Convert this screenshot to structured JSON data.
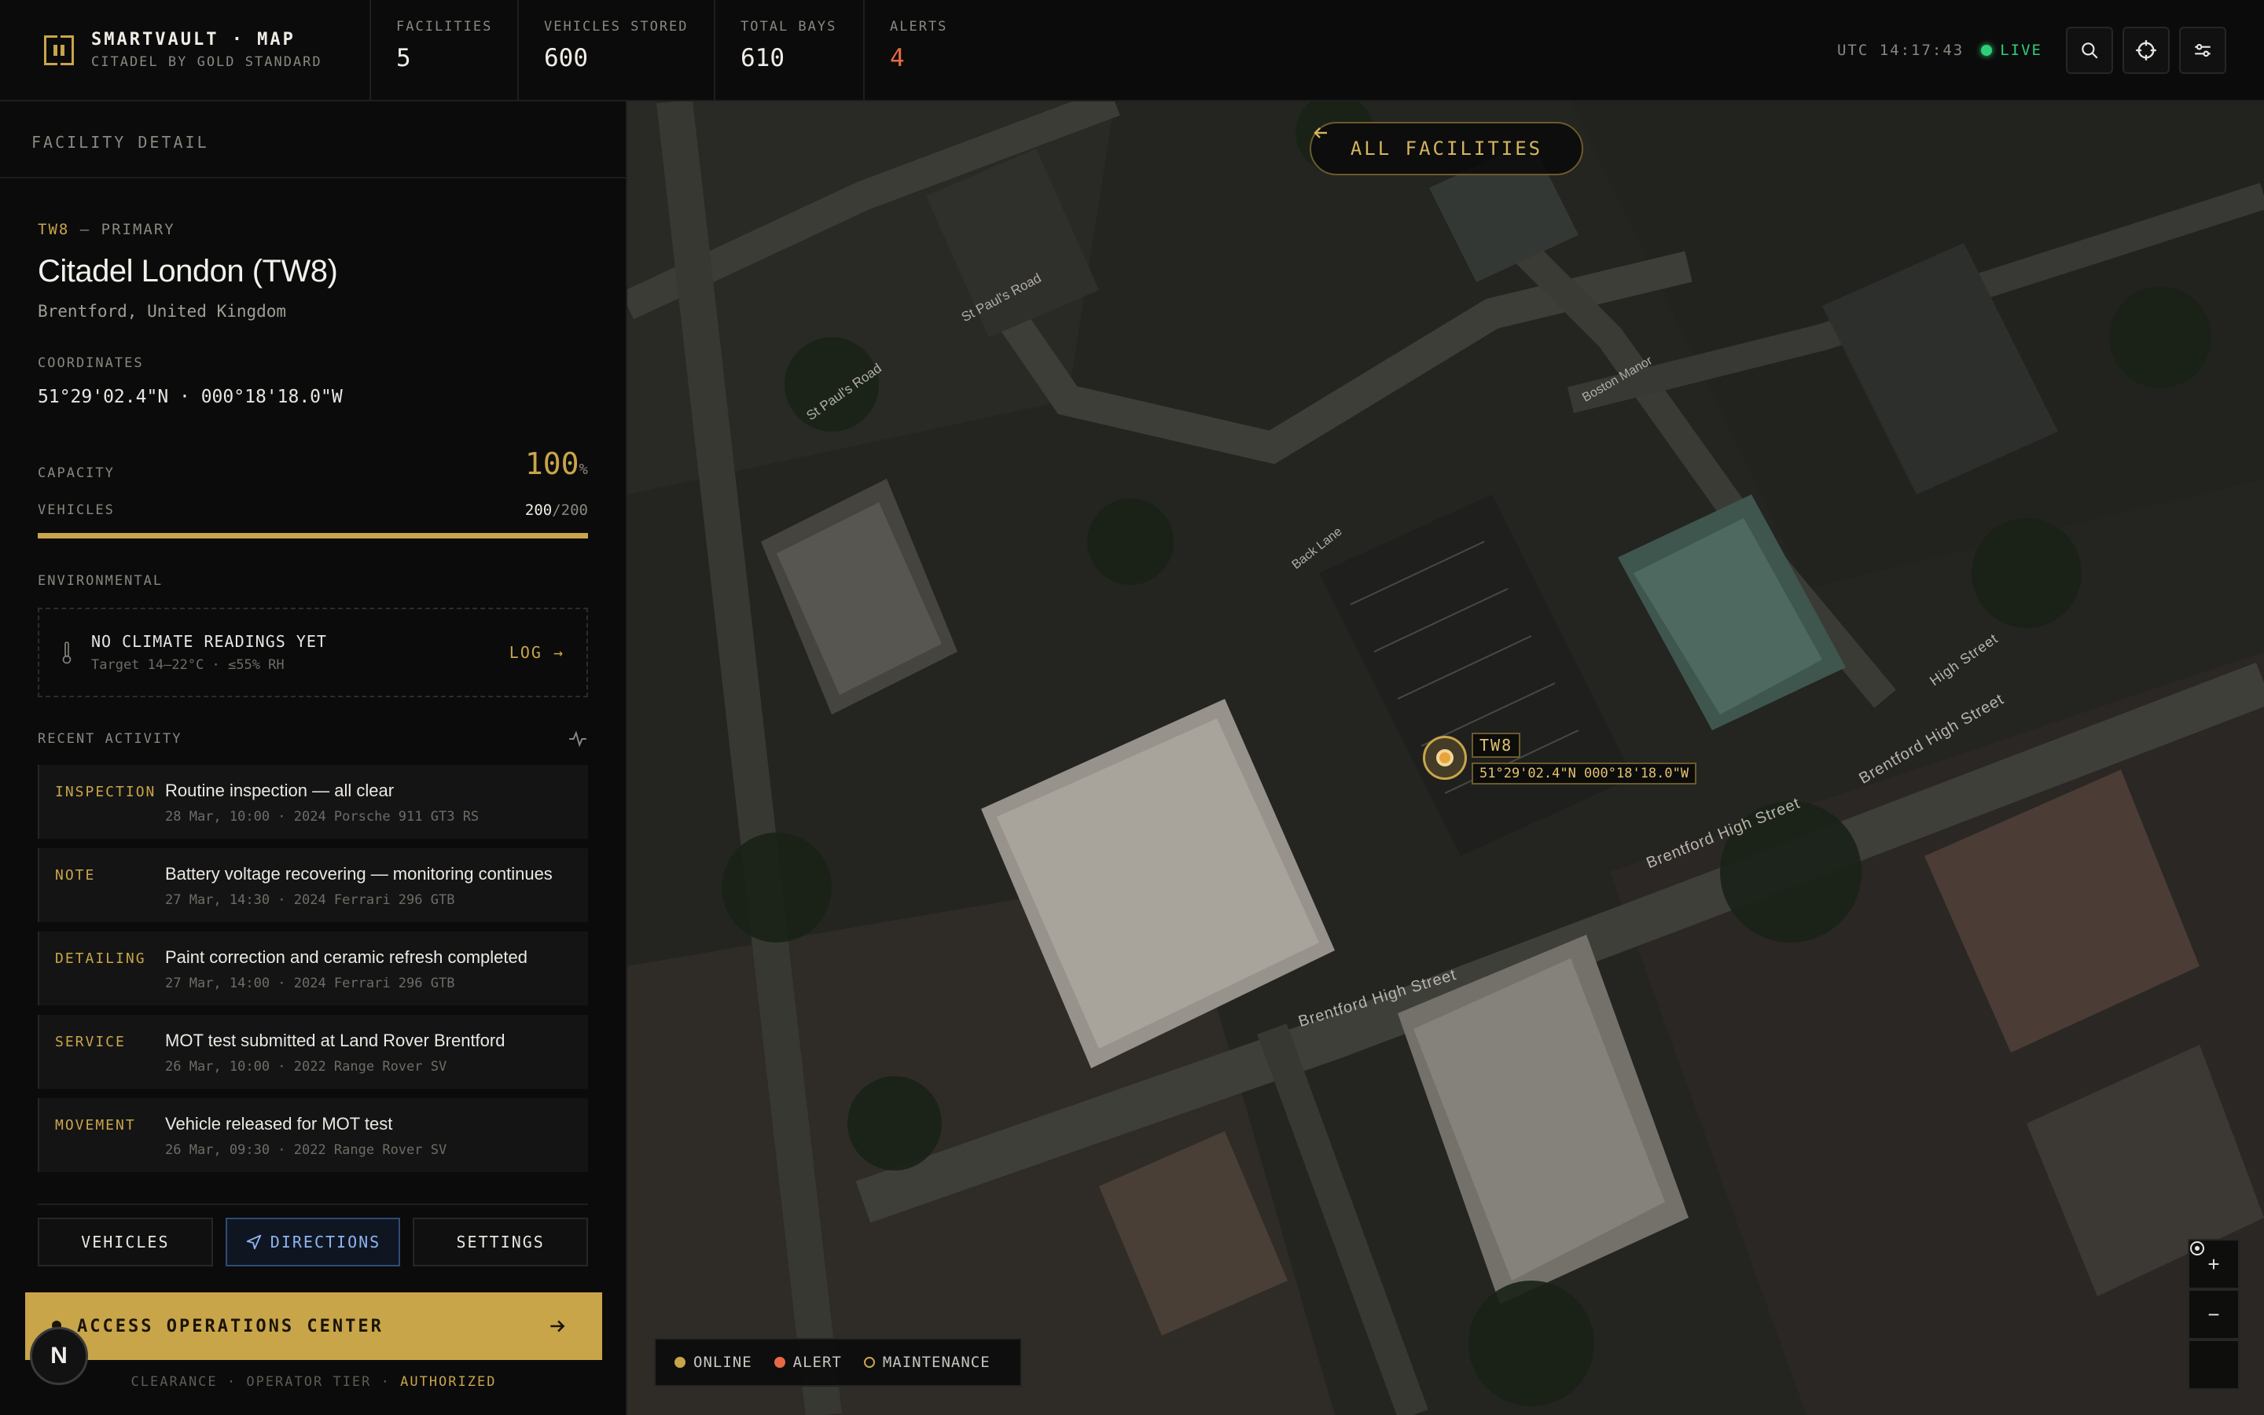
{
  "brand": {
    "title": "SMARTVAULT · MAP",
    "subtitle": "CITADEL BY GOLD STANDARD"
  },
  "stats": [
    {
      "label": "FACILITIES",
      "value": "5"
    },
    {
      "label": "VEHICLES STORED",
      "value": "600"
    },
    {
      "label": "TOTAL BAYS",
      "value": "610"
    },
    {
      "label": "ALERTS",
      "value": "4"
    }
  ],
  "status": {
    "utc": "UTC 14:17:43",
    "live": "LIVE"
  },
  "toolbar_icons": [
    "search-icon",
    "locate-icon",
    "filter-icon"
  ],
  "panel": {
    "header": "FACILITY DETAIL",
    "code": "TW8",
    "tier": "— PRIMARY",
    "name": "Citadel London (TW8)",
    "location": "Brentford, United Kingdom",
    "coords_label": "COORDINATES",
    "coords": "51°29'02.4\"N · 000°18'18.0\"W",
    "capacity_label": "CAPACITY",
    "capacity_value": "100",
    "capacity_unit": "%",
    "capacity_fraction": 1.0,
    "vehicles_label": "VEHICLES",
    "vehicles_count": "200",
    "vehicles_total": "/200",
    "env_label": "ENVIRONMENTAL",
    "env_title": "NO CLIMATE READINGS YET",
    "env_sub": "Target 14–22°C · ≤55% RH",
    "env_log": "LOG →",
    "activity_label": "RECENT ACTIVITY",
    "activity": [
      {
        "type": "INSPECTION",
        "title": "Routine inspection — all clear",
        "meta": "28 Mar, 10:00 · 2024 Porsche 911 GT3 RS"
      },
      {
        "type": "NOTE",
        "title": "Battery voltage recovering — monitoring continues",
        "meta": "27 Mar, 14:30 · 2024 Ferrari 296 GTB"
      },
      {
        "type": "DETAILING",
        "title": "Paint correction and ceramic refresh completed",
        "meta": "27 Mar, 14:00 · 2024 Ferrari 296 GTB"
      },
      {
        "type": "SERVICE",
        "title": "MOT test submitted at Land Rover Brentford",
        "meta": "26 Mar, 10:00 · 2022 Range Rover SV"
      },
      {
        "type": "MOVEMENT",
        "title": "Vehicle released for MOT test",
        "meta": "26 Mar, 09:30 · 2022 Range Rover SV"
      }
    ],
    "tabs": {
      "vehicles": "VEHICLES",
      "directions": "DIRECTIONS",
      "settings": "SETTINGS"
    },
    "ops_button": "ACCESS OPERATIONS CENTER",
    "clearance_prefix": "CLEARANCE · OPERATOR TIER · ",
    "clearance_status": "AUTHORIZED",
    "avatar_letter": "N"
  },
  "map": {
    "back_button": "ALL FACILITIES",
    "marker_code": "TW8",
    "marker_coords": "51°29'02.4\"N 000°18'18.0\"W",
    "street_labels": [
      "Brentford High Street",
      "Brentford High Street",
      "Brentford High Street",
      "High Street",
      "St Paul's Road",
      "St Paul's Road",
      "Back Lane",
      "Boston Manor"
    ],
    "legend": {
      "online": "ONLINE",
      "alert": "ALERT",
      "maintenance": "MAINTENANCE"
    },
    "colors": {
      "online": "#c9a54a",
      "alert": "#e56a43",
      "accent": "#c9a54a",
      "live": "#2fcf7a"
    }
  }
}
